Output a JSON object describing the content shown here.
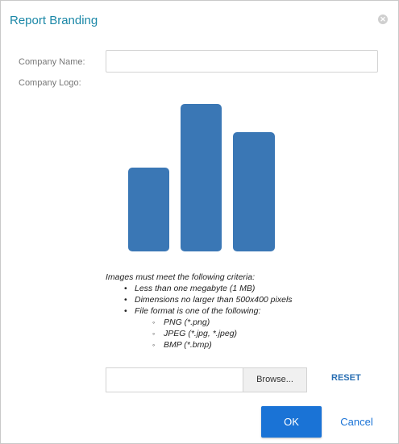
{
  "dialog": {
    "title": "Report Branding",
    "close_icon": "close-circle-icon"
  },
  "form": {
    "company_name_label": "Company Name:",
    "company_name_value": "",
    "company_logo_label": "Company Logo:",
    "logo_icon": "bar-chart-icon",
    "logo_color": "#3a77b5"
  },
  "criteria": {
    "intro": "Images must meet the following criteria:",
    "items": [
      "Less than one megabyte (1 MB)",
      "Dimensions no larger than 500x400 pixels",
      "File format is one of the following:"
    ],
    "formats": [
      "PNG (*.png)",
      "JPEG (*.jpg, *.jpeg)",
      "BMP (*.bmp)"
    ]
  },
  "upload": {
    "file_path": "",
    "browse_label": "Browse...",
    "reset_label": "RESET"
  },
  "actions": {
    "ok_label": "OK",
    "cancel_label": "Cancel"
  },
  "colors": {
    "title": "#1a87a7",
    "primary": "#1a73d6"
  }
}
